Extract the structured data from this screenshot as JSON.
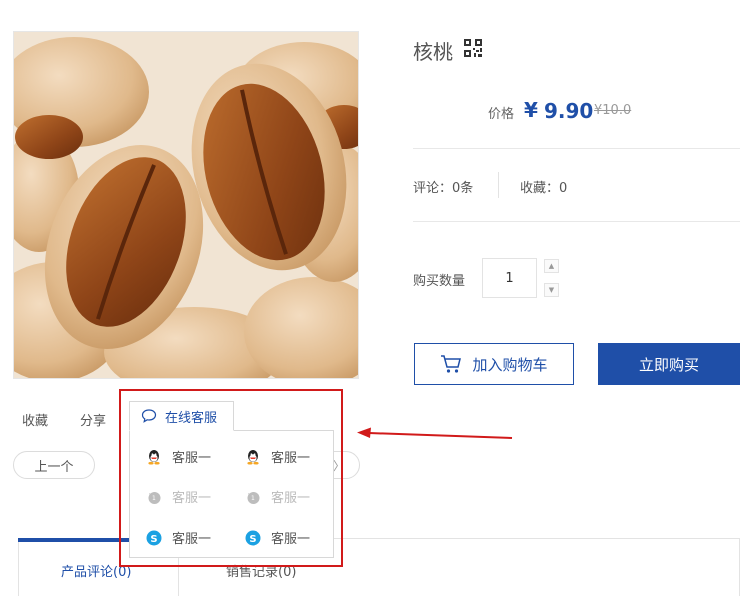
{
  "product": {
    "title": "核桃",
    "price_label": "价格",
    "currency": "¥",
    "price": "9.90",
    "old_price": "¥10.0",
    "reviews": "评论：0条",
    "favorites": "收藏：0",
    "qty_label": "购买数量",
    "qty_value": "1",
    "add_to_cart": "加入购物车",
    "buy_now": "立即购买"
  },
  "actions": {
    "collect": "收藏",
    "share": "分享",
    "prev": "上一个"
  },
  "service": {
    "title": "在线客服",
    "items": [
      {
        "icon": "qq-icon",
        "label": "客服一"
      },
      {
        "icon": "qq-icon",
        "label": "客服一"
      },
      {
        "icon": "wangwang-icon",
        "label": "客服一"
      },
      {
        "icon": "wangwang-icon",
        "label": "客服一"
      },
      {
        "icon": "skype-icon",
        "label": "客服一"
      },
      {
        "icon": "skype-icon",
        "label": "客服一"
      }
    ]
  },
  "tabs": [
    {
      "label": "产品评论(0)"
    },
    {
      "label": "销售记录(0)"
    }
  ],
  "colors": {
    "accent": "#1f4fa8",
    "highlight": "#d11a1a"
  }
}
